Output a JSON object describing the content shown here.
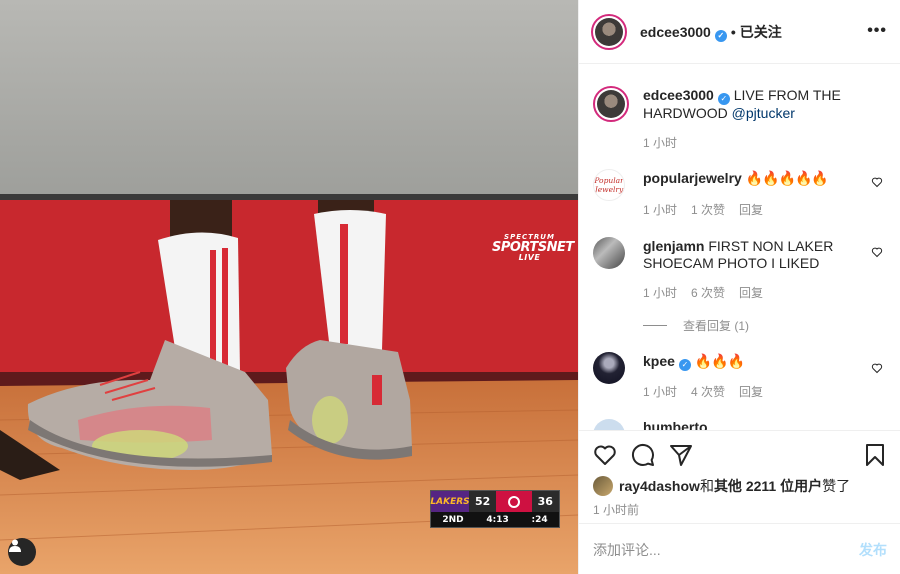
{
  "photo": {
    "network_logo": {
      "line1": "SPECTRUM",
      "line2": "SPORTSNET",
      "line3": "LIVE"
    },
    "scorebug": {
      "away_team": "LAKERS",
      "away_score": "52",
      "home_score": "36",
      "period": "2ND",
      "game_clock": "4:13",
      "shot_clock": ":24"
    }
  },
  "header": {
    "username": "edcee3000",
    "separator": "•",
    "follow_label": "已关注",
    "more_label": "•••"
  },
  "caption": {
    "username": "edcee3000",
    "text": "LIVE FROM THE HARDWOOD",
    "mention": "@pjtucker",
    "time": "1 小时"
  },
  "comments": [
    {
      "username": "popularjewelry",
      "avatar_text": "Popular Jewelry",
      "text": "🔥🔥🔥🔥🔥",
      "time": "1 小时",
      "likes": "1 次赞",
      "reply": "回复"
    },
    {
      "username": "glenjamn",
      "text": "FIRST NON LAKER SHOECAM PHOTO I LIKED",
      "time": "1 小时",
      "likes": "6 次赞",
      "reply": "回复",
      "view_replies": "查看回复 (1)"
    },
    {
      "username": "kpee",
      "text": "🔥🔥🔥",
      "time": "1 小时",
      "likes": "4 次赞",
      "reply": "回复"
    },
    {
      "username": "humberto"
    }
  ],
  "actions": {
    "liked_by_user": "ray4dashow",
    "liked_by_middle": " 和 ",
    "liked_by_others": "其他 2211 位用户",
    "liked_by_suffix": " 赞了",
    "posted_time": "1 小时前",
    "comment_placeholder": "添加评论...",
    "post_label": "发布"
  },
  "colors": {
    "accent_blue": "#3897f0",
    "post_button_disabled": "#b2dffc",
    "muted": "#8e8e8e"
  }
}
